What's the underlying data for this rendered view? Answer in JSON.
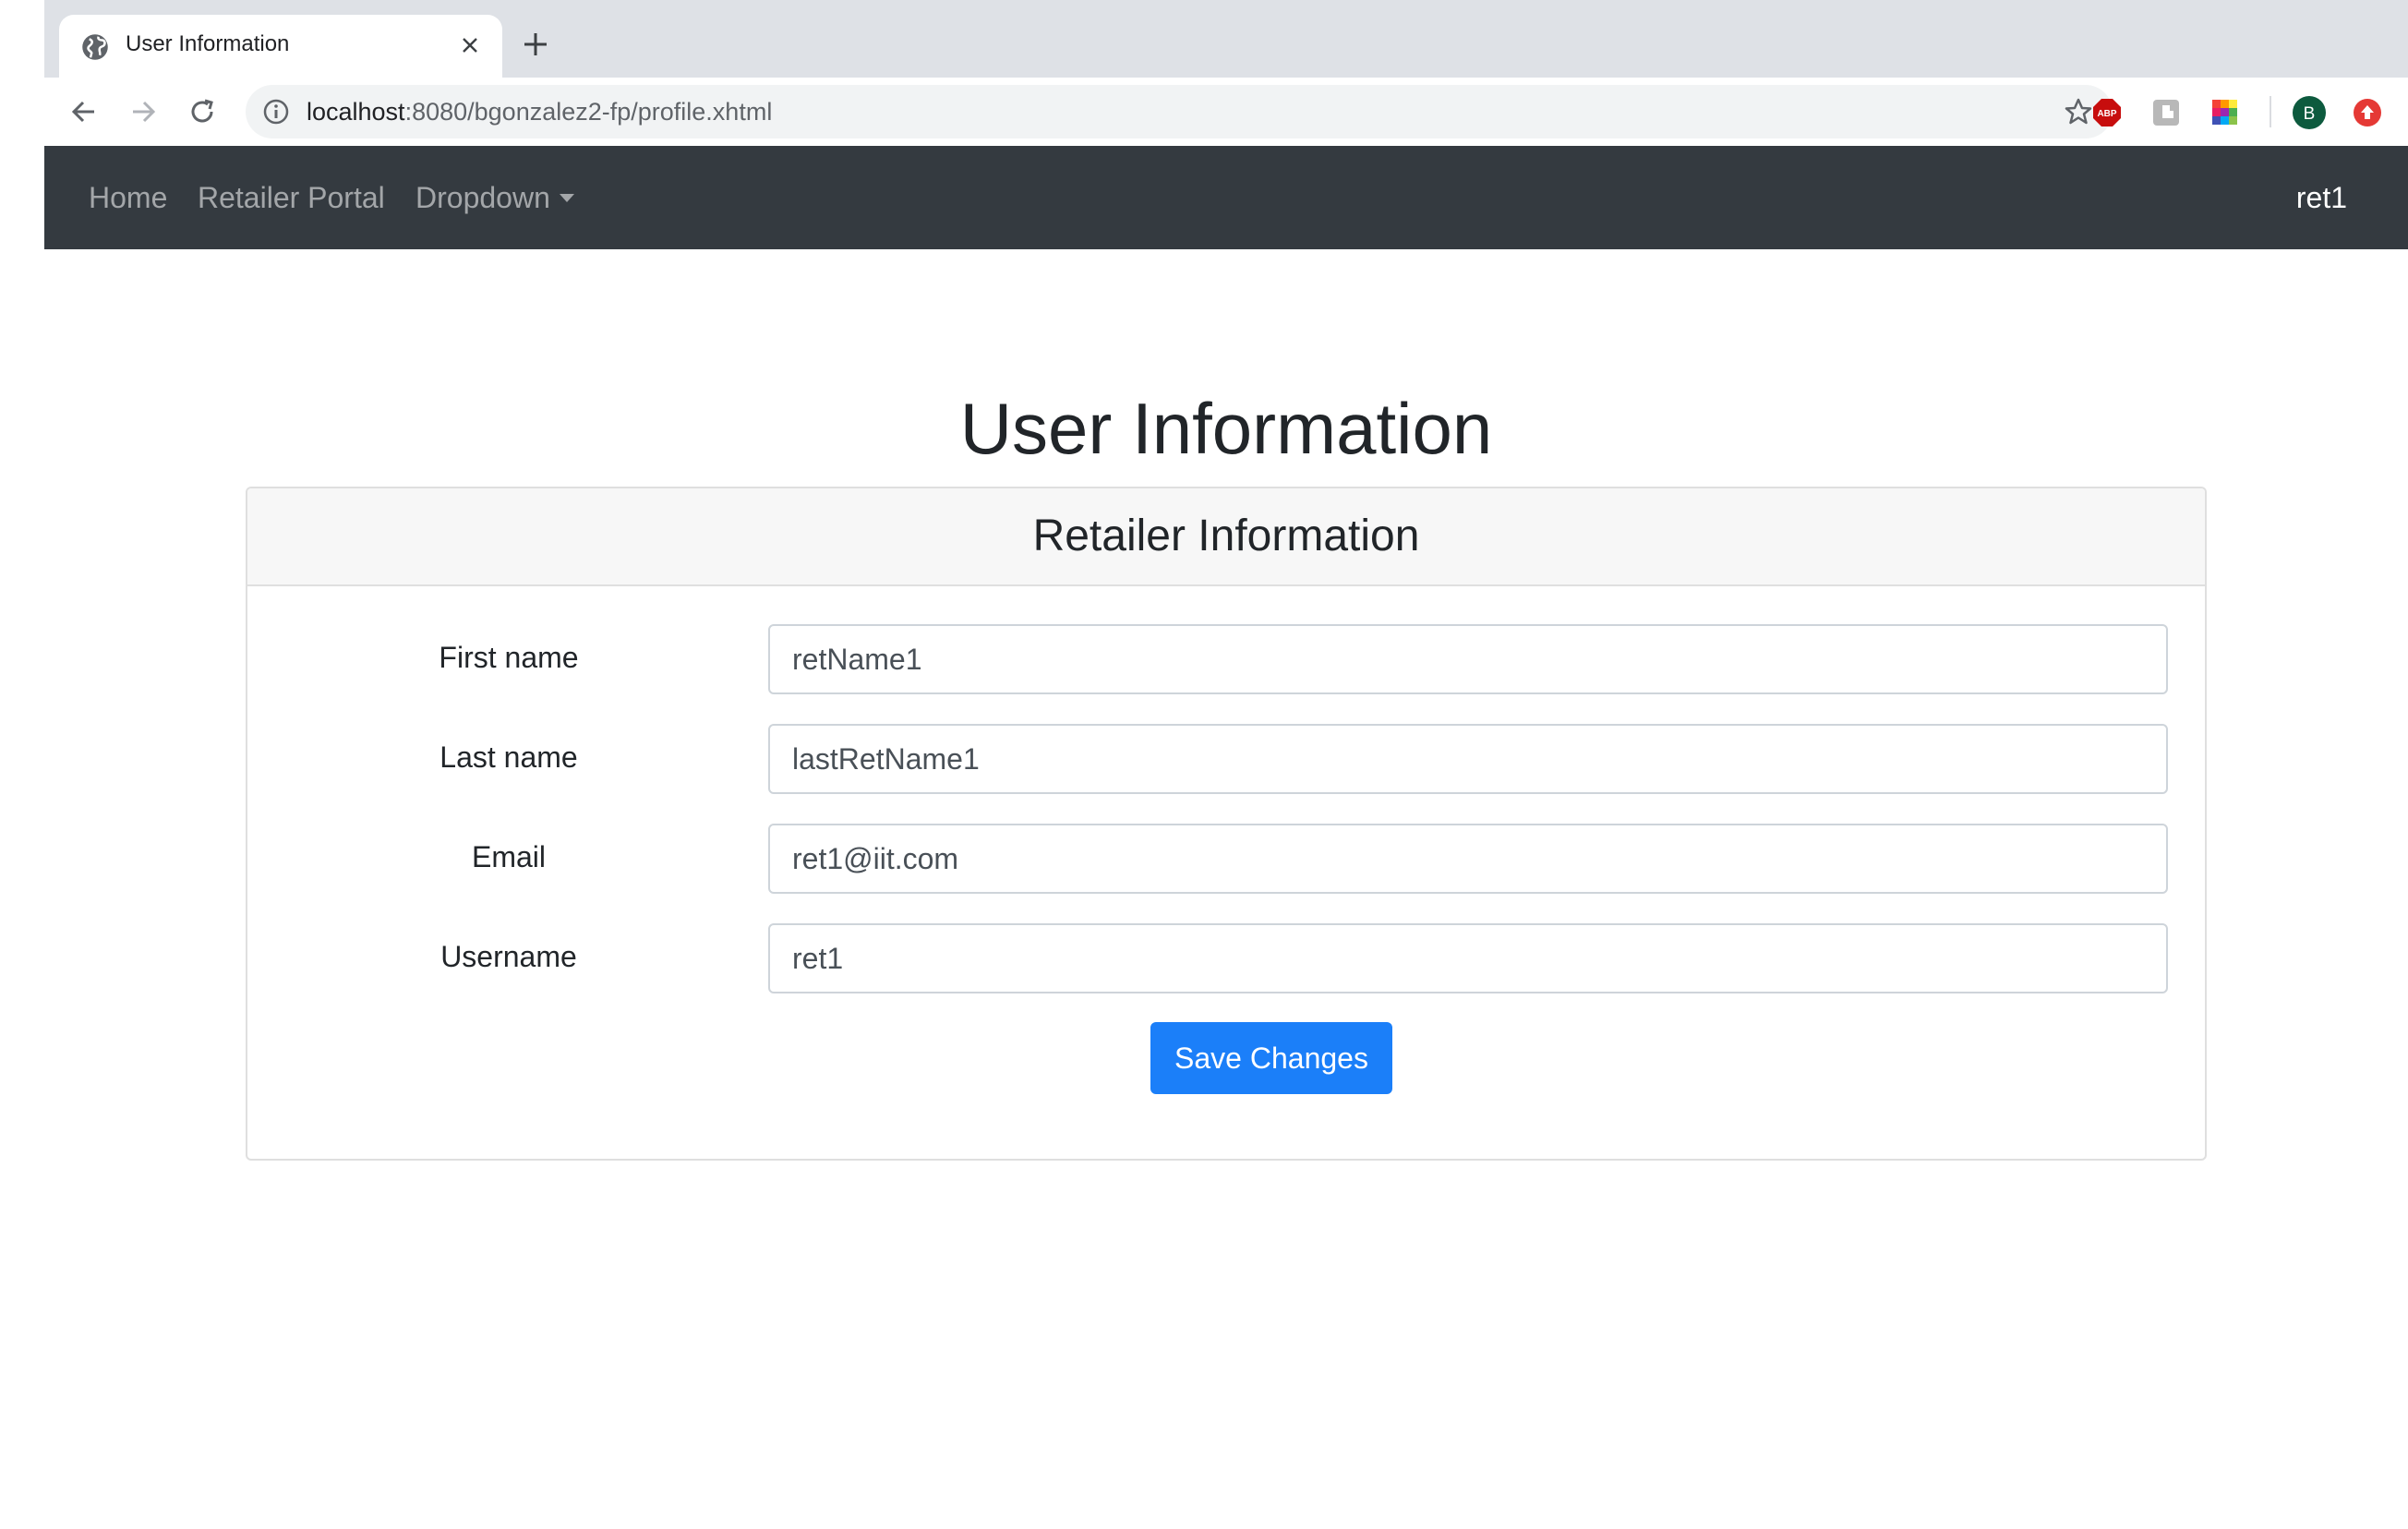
{
  "browser": {
    "tab_title": "User Information",
    "url_host": "localhost",
    "url_path": ":8080/bgonzalez2-fp/profile.xhtml",
    "extensions": [
      "ABP",
      "extension-icon",
      "color-picker-extension",
      "B",
      "upload-extension"
    ]
  },
  "navbar": {
    "links": [
      {
        "label": "Home"
      },
      {
        "label": "Retailer Portal"
      },
      {
        "label": "Dropdown"
      }
    ],
    "user": "ret1",
    "background": "#343a40"
  },
  "page": {
    "heading": "User Information"
  },
  "card": {
    "title": "Retailer Information",
    "fields": [
      {
        "label": "First name",
        "value": "retName1"
      },
      {
        "label": "Last name",
        "value": "lastRetName1"
      },
      {
        "label": "Email",
        "value": "ret1@iit.com"
      },
      {
        "label": "Username",
        "value": "ret1"
      }
    ],
    "save_label": "Save Changes",
    "accent": "#1b7ff9"
  }
}
